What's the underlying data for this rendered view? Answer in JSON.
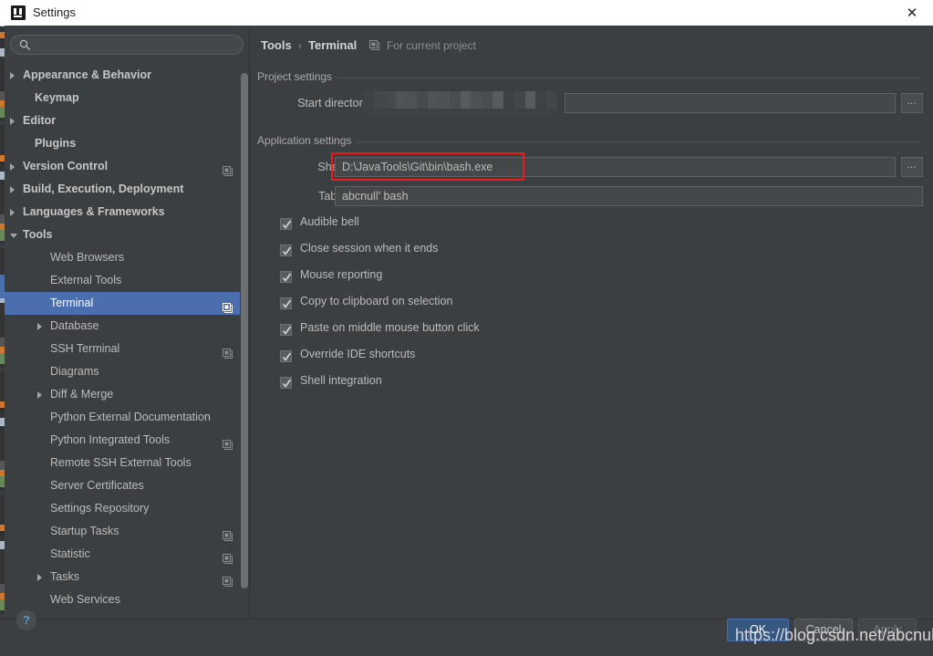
{
  "window": {
    "title": "Settings",
    "app_icon": "intellij-idea-icon",
    "close_label": "✕"
  },
  "sidebar": {
    "search": {
      "value": "",
      "placeholder": "",
      "icon": "search-icon"
    },
    "items": [
      {
        "label": "Appearance & Behavior",
        "indent": 20,
        "arrow": "closed",
        "bold": true,
        "copy": false,
        "selected": false
      },
      {
        "label": "Keymap",
        "indent": 33,
        "arrow": "none",
        "bold": true,
        "copy": false,
        "selected": false
      },
      {
        "label": "Editor",
        "indent": 20,
        "arrow": "closed",
        "bold": true,
        "copy": false,
        "selected": false
      },
      {
        "label": "Plugins",
        "indent": 33,
        "arrow": "none",
        "bold": true,
        "copy": false,
        "selected": false
      },
      {
        "label": "Version Control",
        "indent": 20,
        "arrow": "closed",
        "bold": true,
        "copy": true,
        "selected": false
      },
      {
        "label": "Build, Execution, Deployment",
        "indent": 20,
        "arrow": "closed",
        "bold": true,
        "copy": false,
        "selected": false
      },
      {
        "label": "Languages & Frameworks",
        "indent": 20,
        "arrow": "closed",
        "bold": true,
        "copy": false,
        "selected": false
      },
      {
        "label": "Tools",
        "indent": 20,
        "arrow": "open",
        "bold": true,
        "copy": false,
        "selected": false
      },
      {
        "label": "Web Browsers",
        "indent": 50,
        "arrow": "none",
        "bold": false,
        "copy": false,
        "selected": false
      },
      {
        "label": "External Tools",
        "indent": 50,
        "arrow": "none",
        "bold": false,
        "copy": false,
        "selected": false
      },
      {
        "label": "Terminal",
        "indent": 50,
        "arrow": "none",
        "bold": false,
        "copy": true,
        "selected": true
      },
      {
        "label": "Database",
        "indent": 50,
        "arrow": "closed",
        "bold": false,
        "copy": false,
        "selected": false
      },
      {
        "label": "SSH Terminal",
        "indent": 50,
        "arrow": "none",
        "bold": false,
        "copy": true,
        "selected": false
      },
      {
        "label": "Diagrams",
        "indent": 50,
        "arrow": "none",
        "bold": false,
        "copy": false,
        "selected": false
      },
      {
        "label": "Diff & Merge",
        "indent": 50,
        "arrow": "closed",
        "bold": false,
        "copy": false,
        "selected": false
      },
      {
        "label": "Python External Documentation",
        "indent": 50,
        "arrow": "none",
        "bold": false,
        "copy": false,
        "selected": false
      },
      {
        "label": "Python Integrated Tools",
        "indent": 50,
        "arrow": "none",
        "bold": false,
        "copy": true,
        "selected": false
      },
      {
        "label": "Remote SSH External Tools",
        "indent": 50,
        "arrow": "none",
        "bold": false,
        "copy": false,
        "selected": false
      },
      {
        "label": "Server Certificates",
        "indent": 50,
        "arrow": "none",
        "bold": false,
        "copy": false,
        "selected": false
      },
      {
        "label": "Settings Repository",
        "indent": 50,
        "arrow": "none",
        "bold": false,
        "copy": false,
        "selected": false
      },
      {
        "label": "Startup Tasks",
        "indent": 50,
        "arrow": "none",
        "bold": false,
        "copy": true,
        "selected": false
      },
      {
        "label": "Statistic",
        "indent": 50,
        "arrow": "none",
        "bold": false,
        "copy": true,
        "selected": false
      },
      {
        "label": "Tasks",
        "indent": 50,
        "arrow": "closed",
        "bold": false,
        "copy": true,
        "selected": false
      },
      {
        "label": "Web Services",
        "indent": 50,
        "arrow": "none",
        "bold": false,
        "copy": false,
        "selected": false
      }
    ]
  },
  "main": {
    "breadcrumb": {
      "parent": "Tools",
      "separator": "›",
      "current": "Terminal",
      "scope_icon": "project-scope-icon",
      "scope_label": "For current project"
    },
    "groups": {
      "project_settings": "Project settings",
      "application_settings": "Application settings"
    },
    "fields": [
      {
        "label": "Start directory",
        "value": "",
        "masked": true,
        "browse_label": "…",
        "highlighted": false
      },
      {
        "label": "Shell path",
        "value": "D:\\JavaTools\\Git\\bin\\bash.exe",
        "masked": false,
        "browse_label": "…",
        "highlighted": true
      },
      {
        "label": "Tab name",
        "value": "abcnull' bash",
        "masked": false,
        "browse_label": "",
        "highlighted": false
      }
    ],
    "checkboxes": [
      {
        "label": "Audible bell",
        "checked": true
      },
      {
        "label": "Close session when it ends",
        "checked": true
      },
      {
        "label": "Mouse reporting",
        "checked": true
      },
      {
        "label": "Copy to clipboard on selection",
        "checked": true
      },
      {
        "label": "Paste on middle mouse button click",
        "checked": true
      },
      {
        "label": "Override IDE shortcuts",
        "checked": true
      },
      {
        "label": "Shell integration",
        "checked": true
      }
    ]
  },
  "footer": {
    "help_label": "?",
    "help_icon": "help-question-icon",
    "buttons": [
      {
        "label": "OK",
        "style": "primary"
      },
      {
        "label": "Cancel",
        "style": "normal"
      },
      {
        "label": "Apply",
        "style": "disabled"
      }
    ]
  },
  "overlay": {
    "watermark": "https://blog.csdn.net/abcnull"
  },
  "colors": {
    "window_bg": "#3c3f41",
    "selection": "#4b6eaf",
    "primary_button": "#365880",
    "highlight_box": "#f01a1a",
    "text": "#bbbbbb",
    "title_bar_bg": "#ffffff"
  }
}
